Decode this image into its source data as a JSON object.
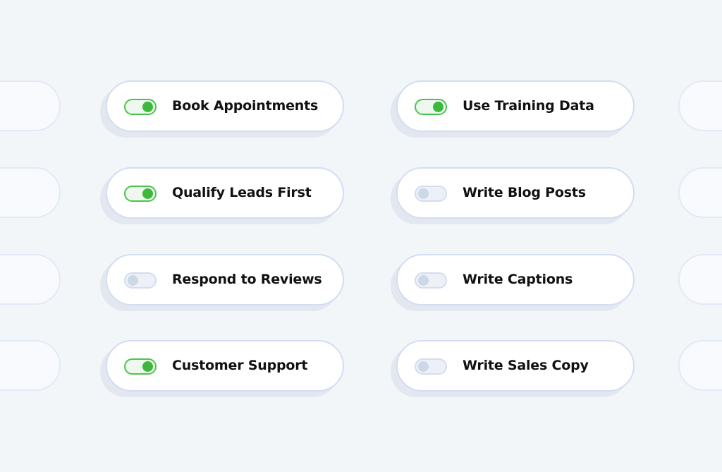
{
  "colors": {
    "background": "#f2f6f9",
    "toggle_on": "#3db83d",
    "toggle_off": "#ccd8e6",
    "card_border": "#d3ddf3"
  },
  "columns": [
    {
      "items": [
        {
          "label": "Book Appointments",
          "enabled": true
        },
        {
          "label": "Qualify Leads First",
          "enabled": true
        },
        {
          "label": "Respond to Reviews",
          "enabled": false
        },
        {
          "label": "Customer Support",
          "enabled": true
        }
      ]
    },
    {
      "items": [
        {
          "label": "Use Training Data",
          "enabled": true
        },
        {
          "label": "Write Blog Posts",
          "enabled": false
        },
        {
          "label": "Write Captions",
          "enabled": false
        },
        {
          "label": "Write Sales Copy",
          "enabled": false
        }
      ]
    }
  ]
}
